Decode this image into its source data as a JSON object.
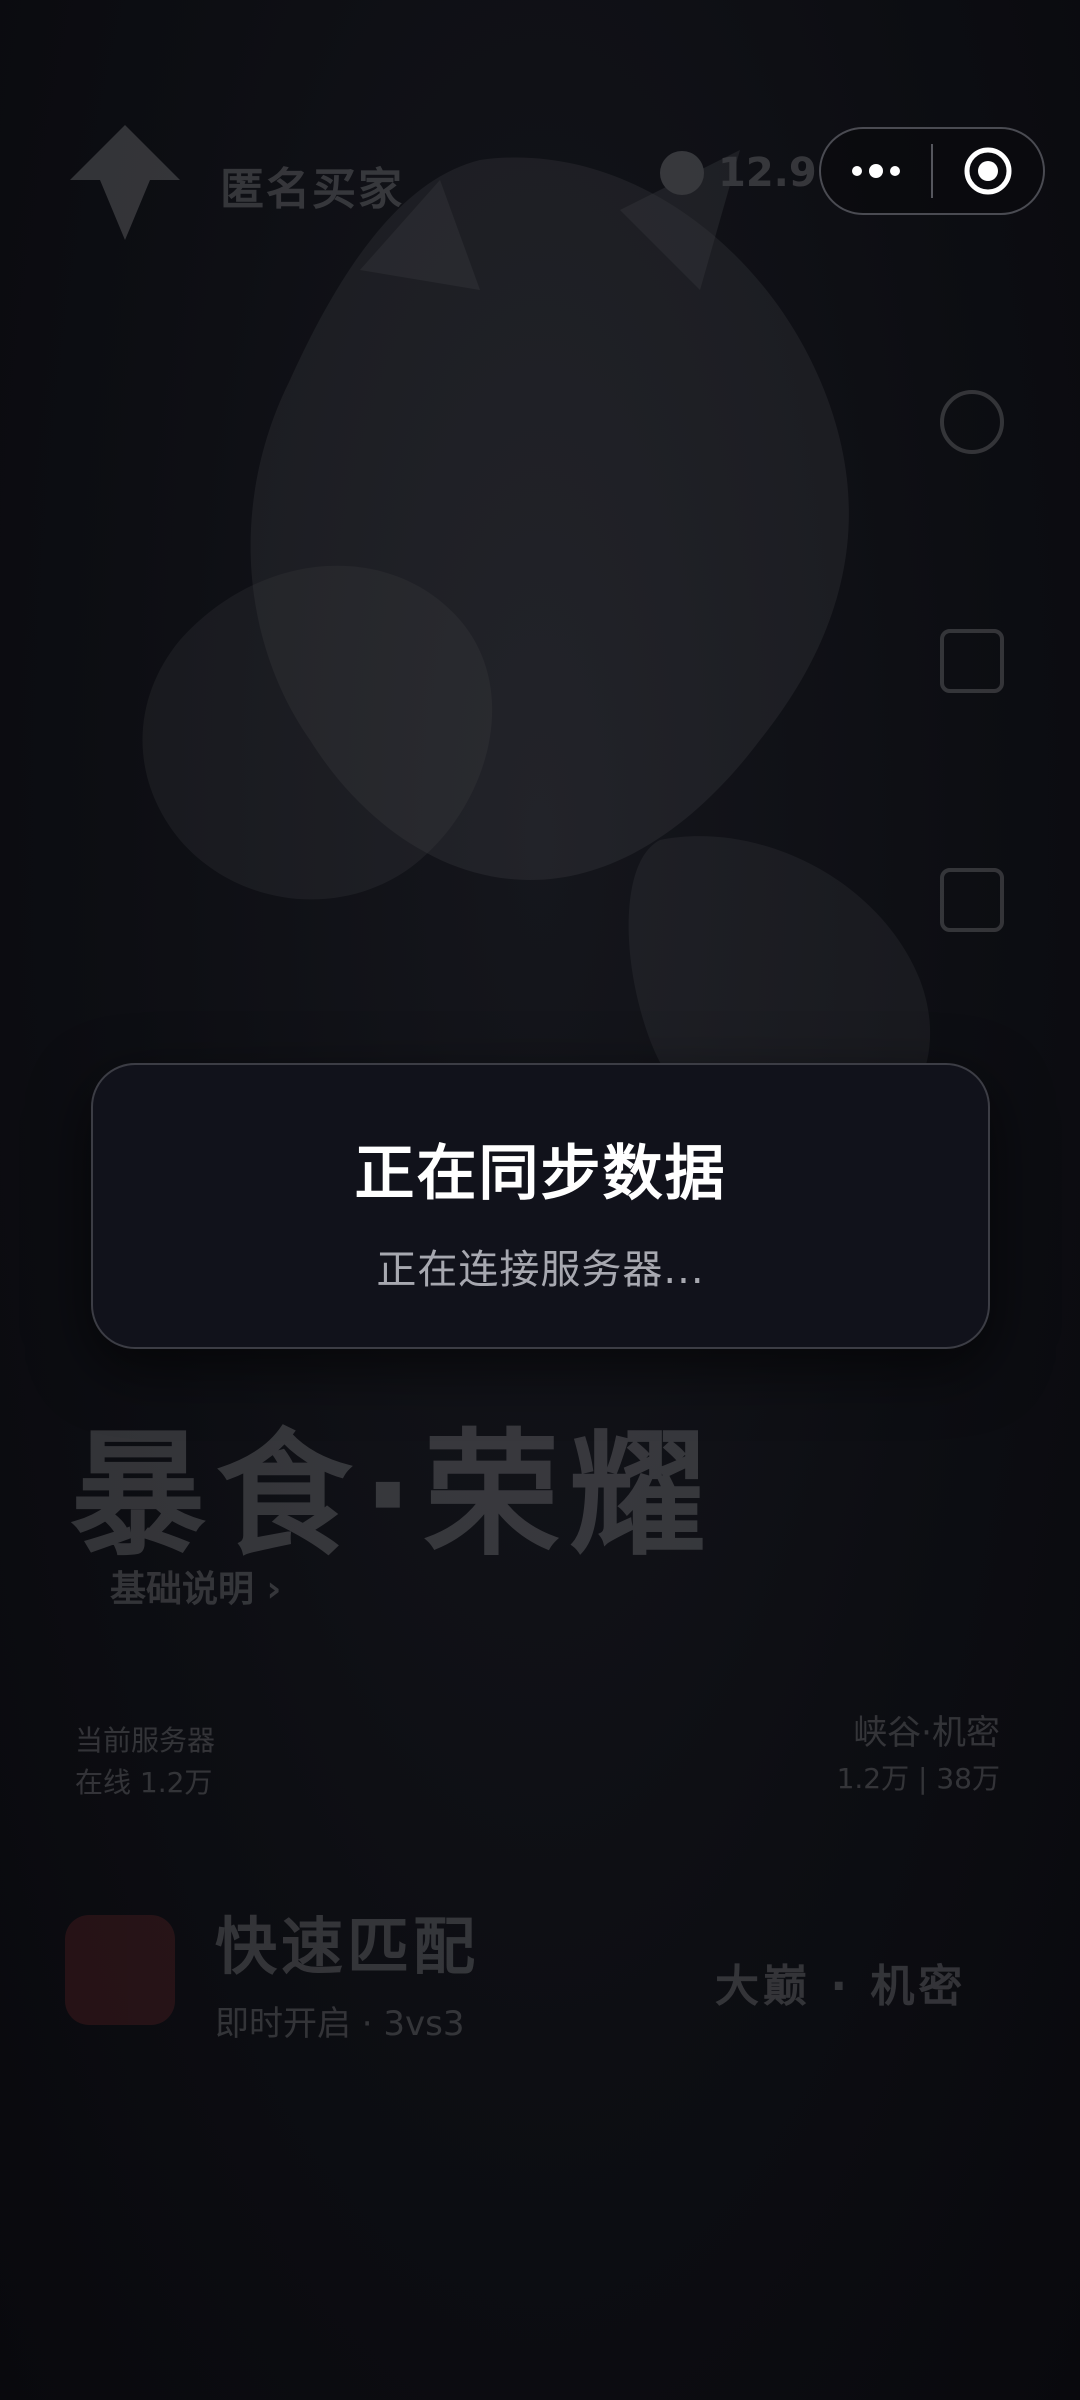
{
  "background": {
    "app_name": "匿名买家",
    "coin_value": "12.9",
    "hero_title": "暴食·荣耀",
    "hero_link": "基础说明 ›",
    "meta_left_1": "当前服务器",
    "meta_left_2": "在线 1.2万",
    "meta_right_1": "峡谷·机密",
    "meta_right_2": "1.2万 | 38万",
    "quick_title": "快速匹配",
    "quick_sub": "即时开启 · 3vs3",
    "quick_mode": "大巅 · 机密"
  },
  "capsule": {
    "more_icon": "more-dots-icon",
    "close_icon": "target-circle-icon"
  },
  "modal": {
    "title": "正在同步数据",
    "subtitle": "正在连接服务器..."
  },
  "colors": {
    "modal_bg": "#11121b",
    "page_bg": "#0c0d12",
    "subtitle": "#a7a8b0"
  }
}
